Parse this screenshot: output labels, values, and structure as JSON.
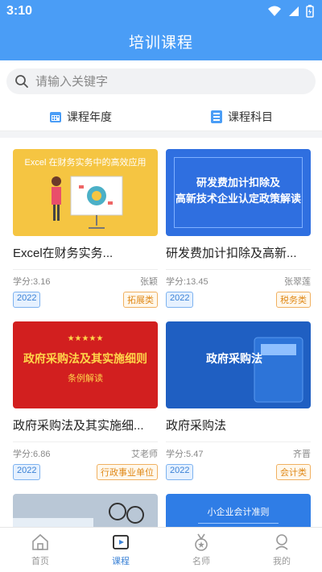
{
  "status": {
    "time": "3:10"
  },
  "header": {
    "title": "培训课程"
  },
  "search": {
    "placeholder": "请输入关键字"
  },
  "filters": [
    {
      "label": "课程年度",
      "icon": "calendar-icon"
    },
    {
      "label": "课程科目",
      "icon": "list-icon"
    }
  ],
  "courses": [
    {
      "title": "Excel在财务实务...",
      "thumb_text": "Excel 在财务实务中的高效应用",
      "credits": "学分:3.16",
      "teacher": "张颖",
      "year": "2022",
      "category": "拓展类"
    },
    {
      "title": "研发费加计扣除及高新...",
      "thumb_text": "研发费加计扣除及\n高新技术企业认定政策解读",
      "credits": "学分:13.45",
      "teacher": "张翠莲",
      "year": "2022",
      "category": "税务类"
    },
    {
      "title": "政府采购法及其实施细...",
      "thumb_text": "政府采购法及其实施细则",
      "thumb_sub": "条例解读",
      "credits": "学分:6.86",
      "teacher": "艾老师",
      "year": "2022",
      "category": "行政事业单位"
    },
    {
      "title": "政府采购法",
      "thumb_text": "政府采购法",
      "credits": "学分:5.47",
      "teacher": "齐晋",
      "year": "2022",
      "category": "会计类"
    },
    {
      "thumb_text": ""
    },
    {
      "thumb_text": "小企业会计准则"
    }
  ],
  "tabs": [
    {
      "label": "首页",
      "icon": "home-icon"
    },
    {
      "label": "课程",
      "icon": "play-icon",
      "active": true
    },
    {
      "label": "名师",
      "icon": "medal-icon"
    },
    {
      "label": "我的",
      "icon": "user-icon"
    }
  ],
  "colors": {
    "primary": "#4a9df6",
    "accent_text": "#3b82d6",
    "tag_orange": "#e08a1a"
  }
}
